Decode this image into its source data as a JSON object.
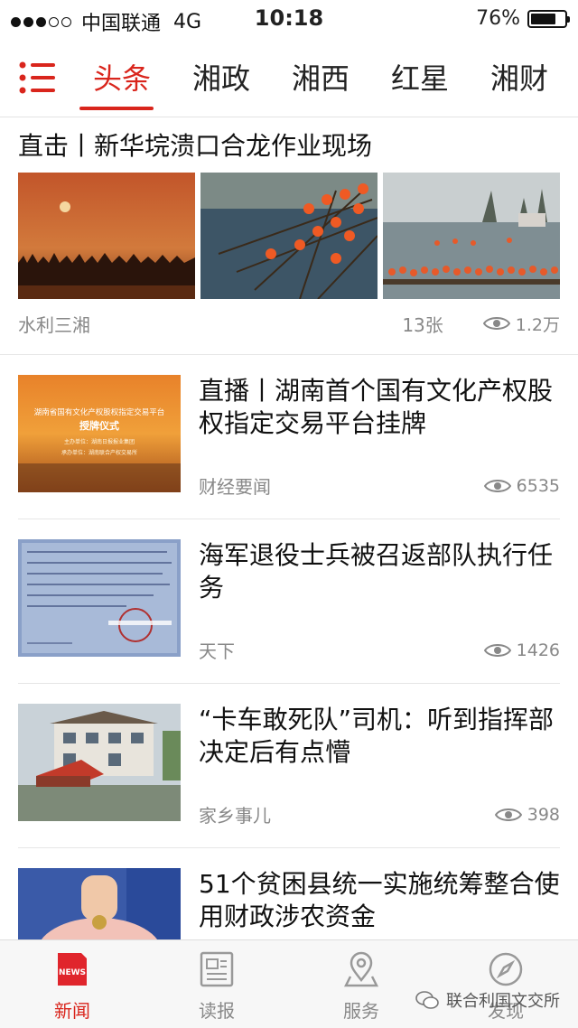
{
  "status": {
    "carrier": "中国联通",
    "network": "4G",
    "time": "10:18",
    "battery": "76%",
    "battery_level": 0.76
  },
  "nav": {
    "tabs": [
      "头条",
      "湘政",
      "湘西",
      "红星",
      "湘财"
    ],
    "active": 0
  },
  "gallery": {
    "title": "直击丨新华垸溃口合龙作业现场",
    "source": "水利三湘",
    "count": "13张",
    "views": "1.2万"
  },
  "articles": [
    {
      "title": "直播丨湖南首个国有文化产权股权指定交易平台挂牌",
      "source": "财经要闻",
      "views": "6535",
      "thumb_text": {
        "line1": "湖南省国有文化产权股权指定交易平台",
        "line2": "授牌仪式",
        "line3": "主办单位：湖南日报报业集团",
        "line4": "承办单位：湖南联合产权交易所"
      }
    },
    {
      "title": "海军退役士兵被召返部队执行任务",
      "source": "天下",
      "views": "1426"
    },
    {
      "title": "“卡车敢死队”司机：听到指挥部决定后有点懵",
      "source": "家乡事儿",
      "views": "398"
    },
    {
      "title": "51个贫困县统一实施统筹整合使用财政涉农资金",
      "source": "",
      "views": ""
    }
  ],
  "bottom": {
    "tabs": [
      "新闻",
      "读报",
      "服务",
      "发现"
    ],
    "news_badge": "NEWS"
  },
  "watermark": "联合利国文交所",
  "colors": {
    "accent": "#d9251c"
  }
}
